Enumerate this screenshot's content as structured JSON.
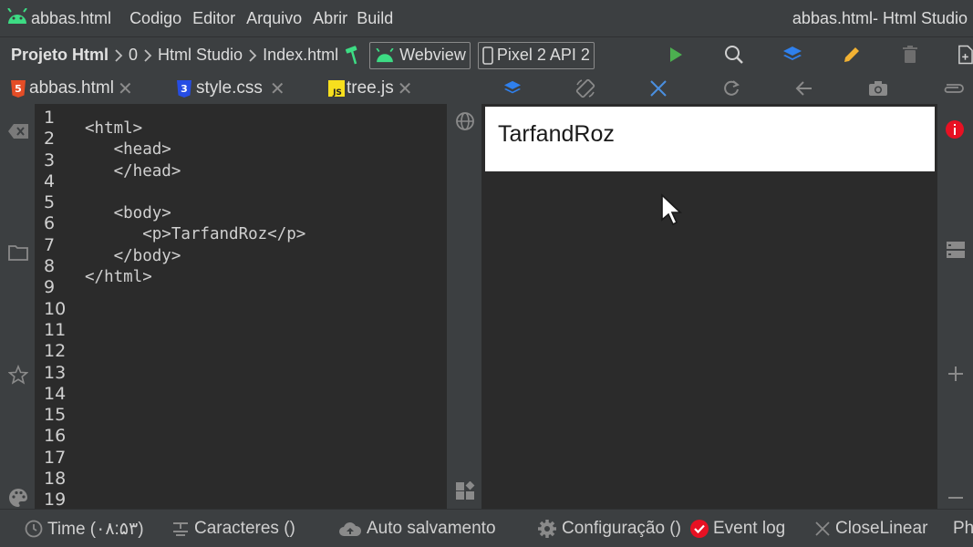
{
  "menubar": {
    "app_file": "abbas.html",
    "items": [
      "Codigo",
      "Editor",
      "Arquivo",
      "Abrir",
      "Build"
    ],
    "window_title": "abbas.html- Html Studio"
  },
  "navbar": {
    "breadcrumbs": [
      "Projeto Html",
      "0",
      "Html Studio",
      "Index.html"
    ],
    "webview_label": "Webview",
    "device_label": "Pixel 2 API 2"
  },
  "tabs": [
    {
      "label": "abbas.html",
      "icon": "html5-icon"
    },
    {
      "label": "style.css",
      "icon": "css3-icon"
    },
    {
      "label": "tree.js",
      "icon": "js-icon"
    }
  ],
  "editor": {
    "line_numbers": [
      "1",
      "2",
      "3",
      "4",
      "5",
      "6",
      "7",
      "8",
      "9",
      "10",
      "11",
      "12",
      "13",
      "14",
      "15",
      "16",
      "17",
      "18",
      "19"
    ],
    "code_lines": [
      "<html>",
      "   <head>",
      "   </head>",
      "",
      "   <body>",
      "      <p>TarfandRoz</p>",
      "   </body>",
      "</html>"
    ]
  },
  "preview": {
    "text": "TarfandRoz"
  },
  "statusbar": {
    "time": "Time (۰۸:۵۳)",
    "characters": "Caracteres ()",
    "autosave": "Auto salvamento",
    "config": "Configuração ()",
    "eventlog": "Event log",
    "close": "CloseLinear",
    "overflow": "Ph"
  },
  "colors": {
    "android_green": "#3ddc84",
    "run_green": "#4caf50",
    "accent_blue": "#2f80ed",
    "pencil_yellow": "#f2b233",
    "error_red": "#e81123",
    "html_orange": "#e44d26",
    "css_blue": "#264de4",
    "js_yellow": "#f7df1e"
  }
}
